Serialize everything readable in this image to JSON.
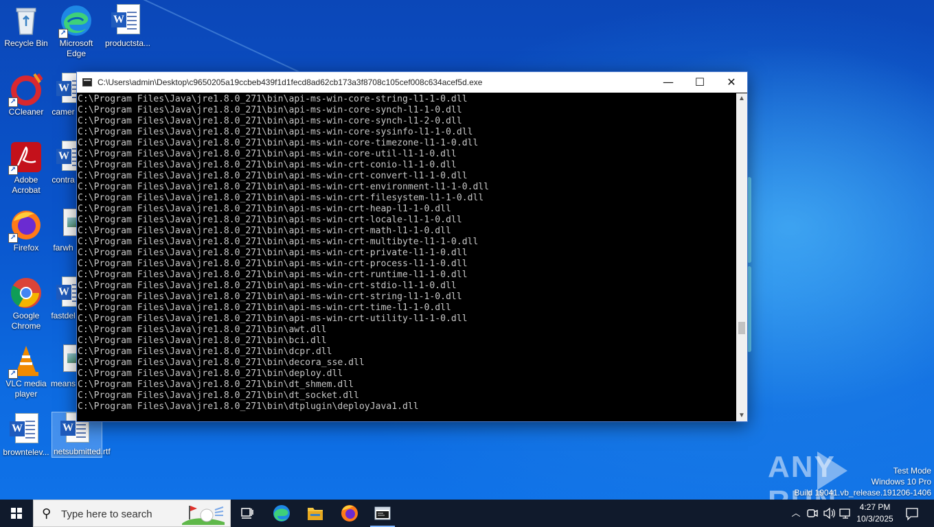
{
  "desktop": {
    "icons": [
      {
        "label": "Recycle Bin"
      },
      {
        "label": "Microsoft Edge"
      },
      {
        "label": "productsta..."
      },
      {
        "label": "CCleaner"
      },
      {
        "label": "camer"
      },
      {
        "label": "Adobe Acrobat"
      },
      {
        "label": "contra"
      },
      {
        "label": "Firefox"
      },
      {
        "label": "farwh"
      },
      {
        "label": "Google Chrome"
      },
      {
        "label": "fastdel"
      },
      {
        "label": "VLC media player"
      },
      {
        "label": "means"
      },
      {
        "label": "browntelev..."
      },
      {
        "label": "netsubmitted.rtf"
      }
    ]
  },
  "console": {
    "title": "C:\\Users\\admin\\Desktop\\c9650205a19ccbeb439f1d1fecd8ad62cb173a3f8708c105cef008c634acef5d.exe",
    "buttons": {
      "minimize": "—",
      "maximize": "☐",
      "close": "✕"
    },
    "lines": [
      "C:\\Program Files\\Java\\jre1.8.0_271\\bin\\api-ms-win-core-string-l1-1-0.dll",
      "C:\\Program Files\\Java\\jre1.8.0_271\\bin\\api-ms-win-core-synch-l1-1-0.dll",
      "C:\\Program Files\\Java\\jre1.8.0_271\\bin\\api-ms-win-core-synch-l1-2-0.dll",
      "C:\\Program Files\\Java\\jre1.8.0_271\\bin\\api-ms-win-core-sysinfo-l1-1-0.dll",
      "C:\\Program Files\\Java\\jre1.8.0_271\\bin\\api-ms-win-core-timezone-l1-1-0.dll",
      "C:\\Program Files\\Java\\jre1.8.0_271\\bin\\api-ms-win-core-util-l1-1-0.dll",
      "C:\\Program Files\\Java\\jre1.8.0_271\\bin\\api-ms-win-crt-conio-l1-1-0.dll",
      "C:\\Program Files\\Java\\jre1.8.0_271\\bin\\api-ms-win-crt-convert-l1-1-0.dll",
      "C:\\Program Files\\Java\\jre1.8.0_271\\bin\\api-ms-win-crt-environment-l1-1-0.dll",
      "C:\\Program Files\\Java\\jre1.8.0_271\\bin\\api-ms-win-crt-filesystem-l1-1-0.dll",
      "C:\\Program Files\\Java\\jre1.8.0_271\\bin\\api-ms-win-crt-heap-l1-1-0.dll",
      "C:\\Program Files\\Java\\jre1.8.0_271\\bin\\api-ms-win-crt-locale-l1-1-0.dll",
      "C:\\Program Files\\Java\\jre1.8.0_271\\bin\\api-ms-win-crt-math-l1-1-0.dll",
      "C:\\Program Files\\Java\\jre1.8.0_271\\bin\\api-ms-win-crt-multibyte-l1-1-0.dll",
      "C:\\Program Files\\Java\\jre1.8.0_271\\bin\\api-ms-win-crt-private-l1-1-0.dll",
      "C:\\Program Files\\Java\\jre1.8.0_271\\bin\\api-ms-win-crt-process-l1-1-0.dll",
      "C:\\Program Files\\Java\\jre1.8.0_271\\bin\\api-ms-win-crt-runtime-l1-1-0.dll",
      "C:\\Program Files\\Java\\jre1.8.0_271\\bin\\api-ms-win-crt-stdio-l1-1-0.dll",
      "C:\\Program Files\\Java\\jre1.8.0_271\\bin\\api-ms-win-crt-string-l1-1-0.dll",
      "C:\\Program Files\\Java\\jre1.8.0_271\\bin\\api-ms-win-crt-time-l1-1-0.dll",
      "C:\\Program Files\\Java\\jre1.8.0_271\\bin\\api-ms-win-crt-utility-l1-1-0.dll",
      "C:\\Program Files\\Java\\jre1.8.0_271\\bin\\awt.dll",
      "C:\\Program Files\\Java\\jre1.8.0_271\\bin\\bci.dll",
      "C:\\Program Files\\Java\\jre1.8.0_271\\bin\\dcpr.dll",
      "C:\\Program Files\\Java\\jre1.8.0_271\\bin\\decora_sse.dll",
      "C:\\Program Files\\Java\\jre1.8.0_271\\bin\\deploy.dll",
      "C:\\Program Files\\Java\\jre1.8.0_271\\bin\\dt_shmem.dll",
      "C:\\Program Files\\Java\\jre1.8.0_271\\bin\\dt_socket.dll",
      "C:\\Program Files\\Java\\jre1.8.0_271\\bin\\dtplugin\\deployJava1.dll"
    ],
    "scroll_position_fraction": 0.74
  },
  "watermark": {
    "text": "ANY RUN"
  },
  "system_info": {
    "line1": "Test Mode",
    "line2": "Windows 10 Pro",
    "line3": "Build 19041.vb_release.191206-1406"
  },
  "taskbar": {
    "search_placeholder": "Type here to search",
    "pinned": [
      {
        "icon": "task-view-icon"
      },
      {
        "icon": "edge-icon"
      },
      {
        "icon": "file-explorer-icon"
      },
      {
        "icon": "firefox-icon"
      },
      {
        "icon": "console-app-icon",
        "active": true
      }
    ],
    "clock": {
      "time": "4:27 PM",
      "date": "10/3/2025"
    }
  },
  "colors": {
    "taskbar": "#101a2c",
    "console_bg": "#000000",
    "console_text": "#c8c8c8",
    "accent": "#7fb6ff"
  }
}
